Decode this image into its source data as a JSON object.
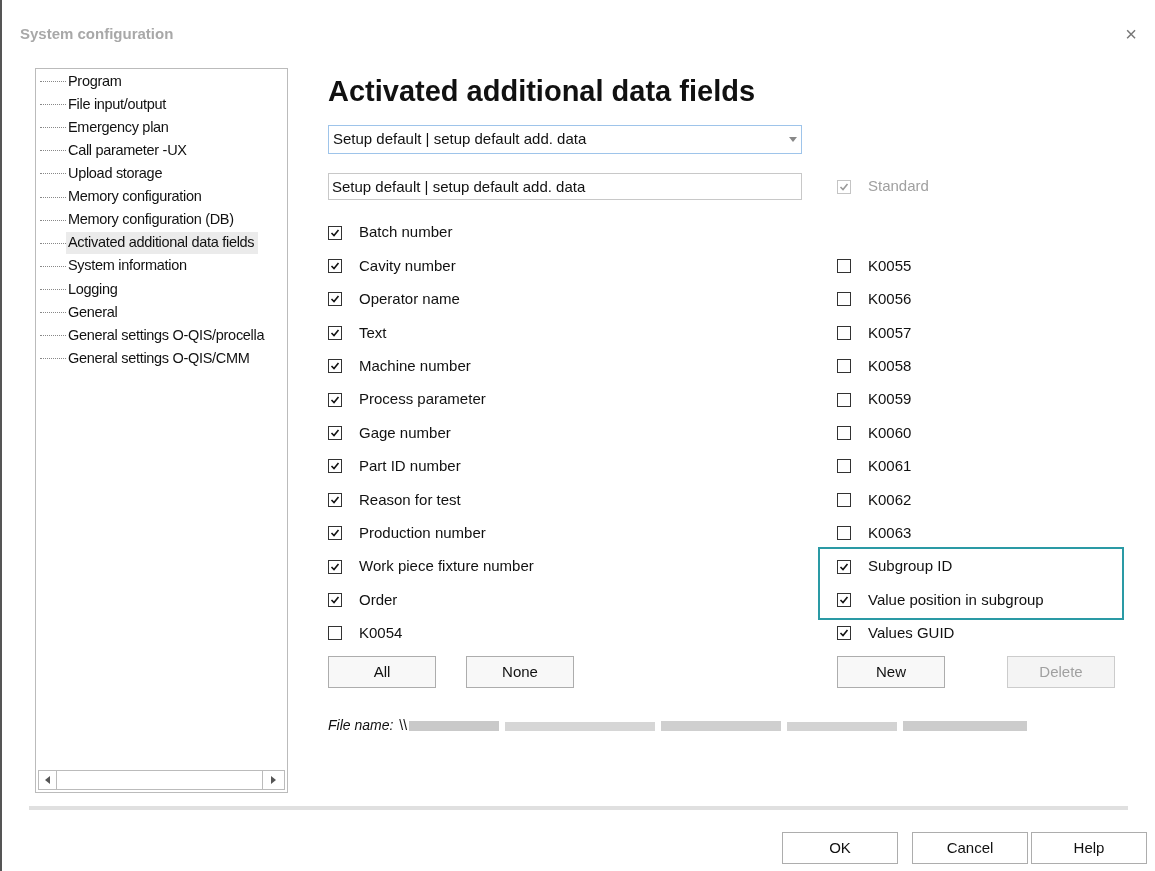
{
  "window": {
    "title": "System configuration",
    "close": "×"
  },
  "tree": {
    "items": [
      {
        "label": "Program",
        "selected": false
      },
      {
        "label": "File input/output",
        "selected": false
      },
      {
        "label": "Emergency plan",
        "selected": false
      },
      {
        "label": "Call parameter  -UX",
        "selected": false
      },
      {
        "label": "Upload storage",
        "selected": false
      },
      {
        "label": "Memory configuration",
        "selected": false
      },
      {
        "label": "Memory configuration (DB)",
        "selected": false
      },
      {
        "label": "Activated additional data fields",
        "selected": true
      },
      {
        "label": "System information",
        "selected": false
      },
      {
        "label": "Logging",
        "selected": false
      },
      {
        "label": "General",
        "selected": false
      },
      {
        "label": "General settings O-QIS/procella",
        "selected": false
      },
      {
        "label": "General settings O-QIS/CMM",
        "selected": false
      }
    ]
  },
  "heading": "Activated additional data fields",
  "setup_dropdown": {
    "value": "Setup default | setup default add. data"
  },
  "setup_name": {
    "value": "Setup default | setup default add. data"
  },
  "standard": {
    "label": "Standard",
    "checked": true,
    "disabled": true
  },
  "left_fields": [
    {
      "label": "Batch number",
      "checked": true
    },
    {
      "label": "Cavity number",
      "checked": true
    },
    {
      "label": "Operator name",
      "checked": true
    },
    {
      "label": "Text",
      "checked": true
    },
    {
      "label": "Machine number",
      "checked": true
    },
    {
      "label": "Process parameter",
      "checked": true
    },
    {
      "label": "Gage number",
      "checked": true
    },
    {
      "label": "Part ID number",
      "checked": true
    },
    {
      "label": "Reason for test",
      "checked": true
    },
    {
      "label": "Production number",
      "checked": true
    },
    {
      "label": "Work piece fixture number",
      "checked": true
    },
    {
      "label": "Order",
      "checked": true
    },
    {
      "label": "K0054",
      "checked": false
    }
  ],
  "right_fields": [
    {
      "label": "K0055",
      "checked": false,
      "highlighted": false
    },
    {
      "label": "K0056",
      "checked": false,
      "highlighted": false
    },
    {
      "label": "K0057",
      "checked": false,
      "highlighted": false
    },
    {
      "label": "K0058",
      "checked": false,
      "highlighted": false
    },
    {
      "label": "K0059",
      "checked": false,
      "highlighted": false
    },
    {
      "label": "K0060",
      "checked": false,
      "highlighted": false
    },
    {
      "label": "K0061",
      "checked": false,
      "highlighted": false
    },
    {
      "label": "K0062",
      "checked": false,
      "highlighted": false
    },
    {
      "label": "K0063",
      "checked": false,
      "highlighted": false
    },
    {
      "label": "Subgroup ID",
      "checked": true,
      "highlighted": true
    },
    {
      "label": "Value position in subgroup",
      "checked": true,
      "highlighted": true
    },
    {
      "label": "Values GUID",
      "checked": true,
      "highlighted": false
    }
  ],
  "left_buttons": [
    {
      "label": "All",
      "disabled": false
    },
    {
      "label": "None",
      "disabled": false
    }
  ],
  "right_buttons": [
    {
      "label": "New",
      "disabled": false
    },
    {
      "label": "Delete",
      "disabled": true
    }
  ],
  "file_name": {
    "label": "File name:",
    "value": "\\\\"
  },
  "footer_buttons": [
    "OK",
    "Cancel",
    "Help"
  ]
}
